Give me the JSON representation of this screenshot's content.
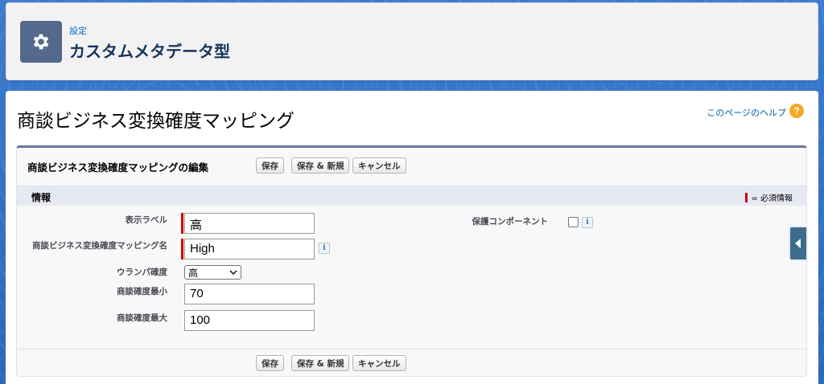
{
  "header": {
    "breadcrumb": "設定",
    "title": "カスタムメタデータ型"
  },
  "page": {
    "title": "商談ビジネス変換確度マッピング",
    "help_link": "このページのヘルプ"
  },
  "edit": {
    "title": "商談ビジネス変換確度マッピングの編集",
    "buttons": {
      "save": "保存",
      "save_new": "保存 & 新規",
      "cancel": "キャンセル"
    }
  },
  "section": {
    "title": "情報",
    "required_legend": "= 必須情報"
  },
  "fields": {
    "display_label": {
      "label": "表示ラベル",
      "value": "高"
    },
    "mapping_name": {
      "label": "商談ビジネス変換確度マッピング名",
      "value": "High"
    },
    "urampa": {
      "label": "ウランパ確度",
      "value": "高"
    },
    "min": {
      "label": "商談確度最小",
      "value": "70"
    },
    "max": {
      "label": "商談確度最大",
      "value": "100"
    },
    "protected": {
      "label": "保護コンポーネント",
      "checked": false
    }
  },
  "icons": {
    "gear": "gear-icon",
    "help": "help-icon",
    "info": "info-icon",
    "side_tab": "chevron-left-icon"
  },
  "colors": {
    "brand_bg": "#2e6fc0",
    "required": "#cc0000",
    "gear_tile": "#54698d",
    "help_badge": "#f7a826"
  }
}
